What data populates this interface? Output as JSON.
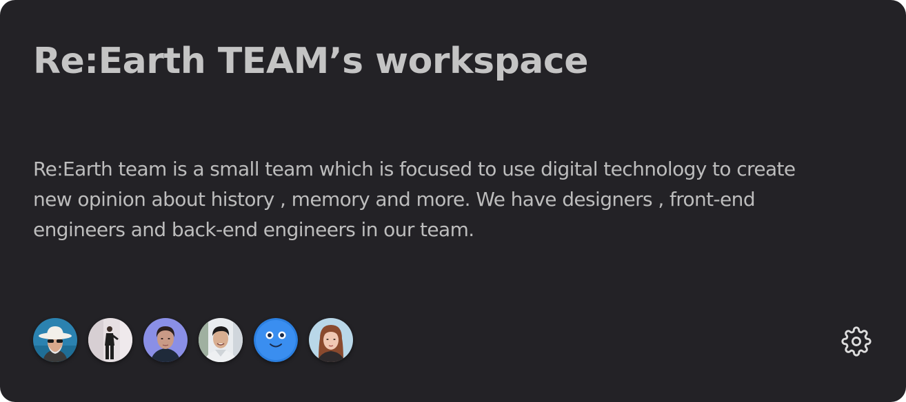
{
  "workspace": {
    "title": "Re:Earth TEAM’s workspace",
    "description": "Re:Earth team is a small team which is focused to use digital technology to create new opinion about history , memory and more. We have designers , front-end engineers and back-end engineers in our team."
  },
  "members": [
    {
      "avatar": "photo-man-white-hat-sunglasses",
      "bg": "#2b82b0"
    },
    {
      "avatar": "photo-person-standing-black-outfit",
      "bg": "#e6dfe2"
    },
    {
      "avatar": "photo-person-purple-background",
      "bg": "#8a8fe6"
    },
    {
      "avatar": "photo-man-smiling-light-background",
      "bg": "#e9ecef"
    },
    {
      "avatar": "blue-smiley-face",
      "bg": "#3a8ef0"
    },
    {
      "avatar": "photo-woman-red-hair",
      "bg": "#b9d7e8"
    }
  ],
  "actions": {
    "settings_icon": "gear-icon"
  },
  "colors": {
    "card_background": "#232226",
    "title_text": "#c4c4c4",
    "body_text": "#bdbdbd",
    "icon": "#dddddd"
  }
}
